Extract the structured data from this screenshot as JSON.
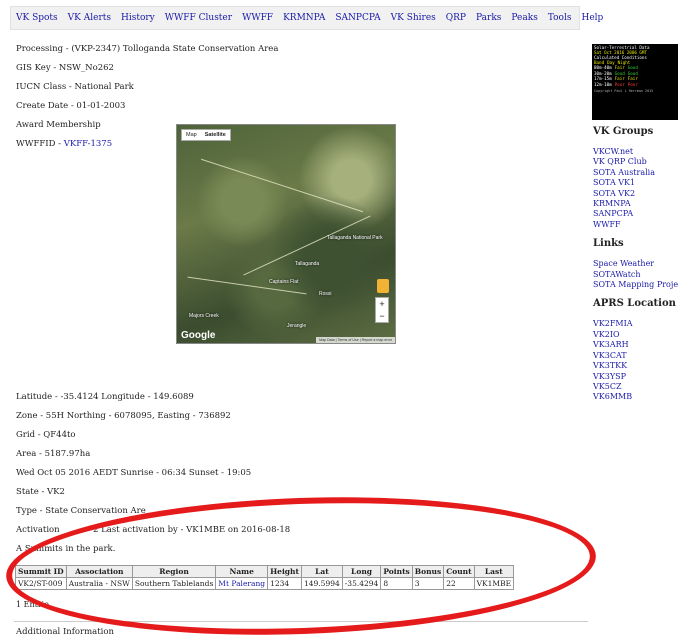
{
  "nav": {
    "items": [
      "VK Spots",
      "VK Alerts",
      "History",
      "WWFF Cluster",
      "WWFF",
      "KRMNPA",
      "SANPCPA",
      "VK Shires",
      "QRP",
      "Parks",
      "Peaks",
      "Tools",
      "Help"
    ]
  },
  "park": {
    "processing": "Processing - (VKP-2347) Tolloganda State Conservation Area",
    "gis_key": "GIS Key - NSW_No262",
    "iucn": "IUCN Class - National Park",
    "create_date": "Create Date - 01-01-2003",
    "award": "Award Membership",
    "wwffid_prefix": "WWFFID - ",
    "wwffid_link": "VKFF-1375",
    "lat_long": "Latitude - -35.4124 Longitude - 149.6089",
    "zone": "Zone - 55H Northing - 6078095, Easting - 736892",
    "grid": "Grid - QF44to",
    "area": "Area - 5187.97ha",
    "sun": "Wed Oct 05 2016 AEDT Sunrise - 06:34 Sunset - 19:05",
    "state": "State - VK2",
    "type": "Type - State Conservation Are",
    "activation": "Activation",
    "activation_rest": "2 Last activation by - VK1MBE on 2016-08-18",
    "summits_intro": "A Summits in the park.",
    "entries": "1 Entrie",
    "additional": "Additional Information"
  },
  "map": {
    "btn_map": "Map",
    "btn_satellite": "Satellite",
    "labels": [
      "Tallaganda",
      "Tallaganda National Park",
      "Captains Flat",
      "Rossi",
      "Majors Creek",
      "Jerangle"
    ],
    "google": "Google",
    "footer": "Map Data | Terms of Use | Report a map error",
    "zoom_in": "+",
    "zoom_out": "−"
  },
  "table": {
    "headers": [
      "Summit ID",
      "Association",
      "Region",
      "Name",
      "Height",
      "Lat",
      "Long",
      "Points",
      "Bonus",
      "Count",
      "Last"
    ],
    "rows": [
      [
        "VK2/ST-009",
        "Australia - NSW",
        "Southern Tablelands",
        "Mt Palerang",
        "1234",
        "149.5994",
        "-35.4294",
        "8",
        "3",
        "22",
        "VK1MBE"
      ]
    ]
  },
  "solar": {
    "title": "Solar-Terrestrial Data",
    "date": "Sat Oct 2016 2006 GMT",
    "heading": "Calculated Conditions",
    "cols": [
      "Band",
      "Day",
      "Night"
    ],
    "rows": [
      [
        "80m-40m",
        "Fair",
        "Good"
      ],
      [
        "30m-20m",
        "Good",
        "Good"
      ],
      [
        "17m-15m",
        "Fair",
        "Fair"
      ],
      [
        "12m-10m",
        "Poor",
        "Poor"
      ]
    ],
    "footer": "Copyright Paul L Herrman 2015"
  },
  "sidebar": {
    "groups_title": "VK Groups",
    "groups": [
      "VKCW.net",
      "VK QRP Club",
      "SOTA Australia",
      "SOTA VK1",
      "SOTA VK2",
      "KRMNPA",
      "SANPCPA",
      "WWFF"
    ],
    "links_title": "Links",
    "links": [
      "Space Weather",
      "SOTAWatch",
      "SOTA Mapping Project"
    ],
    "aprs_title": "APRS Location",
    "aprs": [
      "VK2FMIA",
      "VK2IO",
      "VK3ARH",
      "VK3CAT",
      "VK3TKK",
      "VK3YSP",
      "VK5CZ",
      "VK6MMB"
    ]
  },
  "colors": {
    "link": "#1a1aa8",
    "annotation": "#e51b1b"
  }
}
